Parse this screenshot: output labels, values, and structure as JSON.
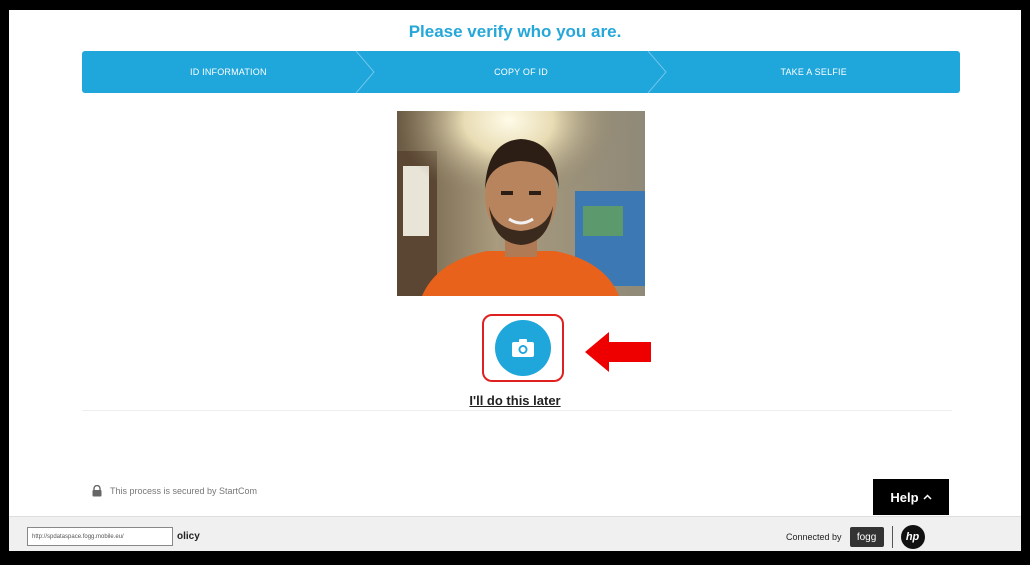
{
  "header": {
    "title": "Please verify who you are."
  },
  "steps": [
    {
      "label": "ID INFORMATION"
    },
    {
      "label": "COPY OF ID"
    },
    {
      "label": "TAKE A SELFIE"
    }
  ],
  "capture": {
    "camera_icon": "camera-icon",
    "later_link": "I'll do this later"
  },
  "security": {
    "lock_icon": "lock-icon",
    "text": "This process is secured by StartCom"
  },
  "help": {
    "label": "Help",
    "chevron": "^"
  },
  "footer": {
    "url_tooltip": "http://spdataspace.fogg.mobile.eu/",
    "policy_label": "olicy",
    "connected_label": "Connected by",
    "fogg_label": "fogg",
    "hp_label": "hp"
  },
  "colors": {
    "accent": "#1fa6db",
    "title": "#25a7d9",
    "highlight": "#e02020"
  }
}
